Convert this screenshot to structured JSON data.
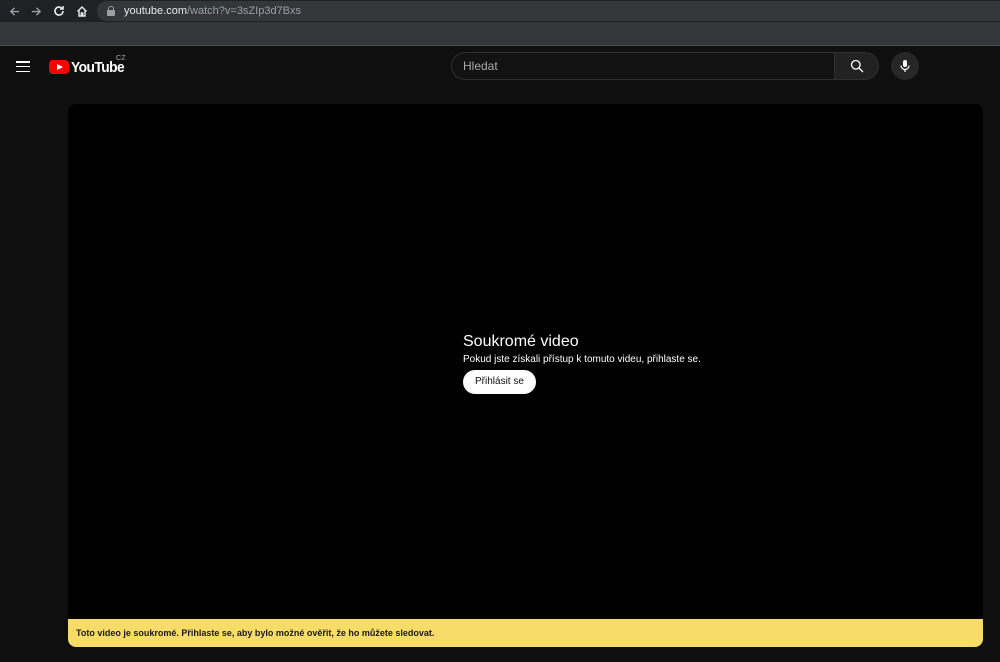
{
  "browser": {
    "url_domain": "youtube.com",
    "url_path": "/watch?v=3sZIp3d7Bxs",
    "icons": {
      "back": "arrow-left-icon",
      "forward": "arrow-right-icon",
      "reload": "reload-icon",
      "home": "home-icon",
      "lock": "lock-icon"
    }
  },
  "masthead": {
    "logo_text": "YouTube",
    "country_code": "CZ",
    "search_placeholder": "Hledat",
    "icons": {
      "menu": "menu-icon",
      "search": "search-icon",
      "mic": "mic-icon"
    }
  },
  "player": {
    "title": "Soukromé video",
    "subtitle": "Pokud jste získali přístup k tomuto videu, přihlaste se.",
    "signin_label": "Přihlásit se",
    "notice": "Toto video je soukromé. Přihlaste se, aby bylo možné ověřit, že ho můžete sledovat."
  },
  "colors": {
    "background": "#0f0f0f",
    "logo_red": "#ff0000",
    "notice_yellow": "#f8dc6a"
  }
}
